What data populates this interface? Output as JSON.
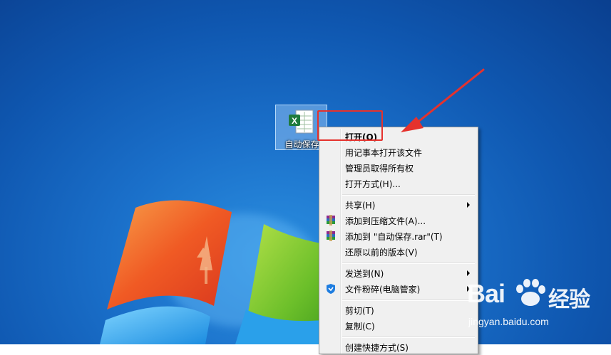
{
  "desktop": {
    "icon": {
      "name": "excel-file-icon",
      "label": "自动保存"
    }
  },
  "context_menu": {
    "items": [
      {
        "label": "打开(O)",
        "bold": true
      },
      {
        "label": "用记事本打开该文件"
      },
      {
        "label": "管理员取得所有权"
      },
      {
        "label": "打开方式(H)..."
      },
      {
        "label": "共享(H)",
        "submenu": true
      },
      {
        "label": "添加到压缩文件(A)...",
        "icon": "winrar-icon"
      },
      {
        "label": "添加到 \"自动保存.rar\"(T)",
        "icon": "winrar-icon"
      },
      {
        "label": "还原以前的版本(V)"
      },
      {
        "label": "发送到(N)",
        "submenu": true
      },
      {
        "label": "文件粉碎(电脑管家)",
        "icon": "pc-manager-shield-icon",
        "submenu": true
      },
      {
        "label": "剪切(T)"
      },
      {
        "label": "复制(C)"
      },
      {
        "label": "创建快捷方式(S)"
      }
    ]
  },
  "annotation": {
    "highlight_color": "#e5322d"
  },
  "watermark": {
    "brand": "Bai",
    "brand_suffix": "经验",
    "url": "jingyan.baidu.com"
  },
  "colors": {
    "desktop_blue": "#1a6fc9",
    "menu_bg": "#f0f0f0"
  }
}
